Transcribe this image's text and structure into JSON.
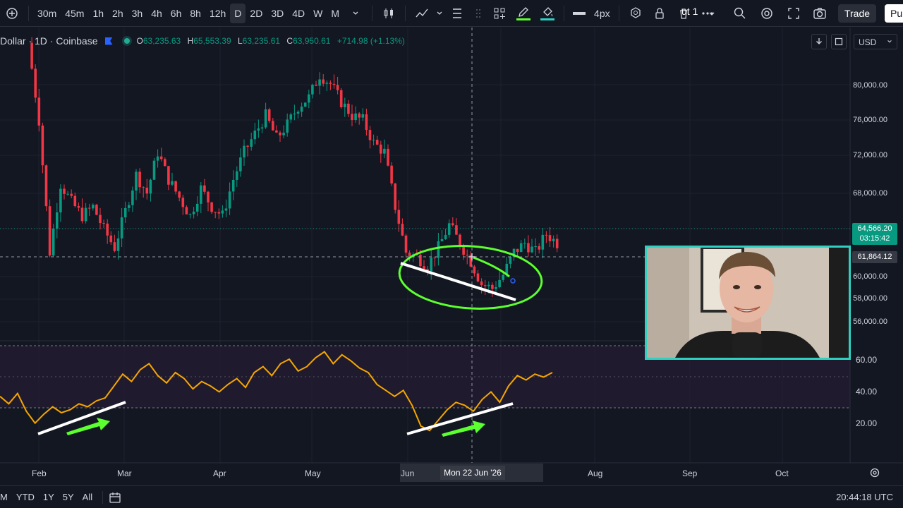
{
  "toolbar": {
    "intervals": [
      "30m",
      "45m",
      "1h",
      "2h",
      "3h",
      "4h",
      "6h",
      "8h",
      "12h",
      "D",
      "2D",
      "3D",
      "4D",
      "W",
      "M"
    ],
    "active_interval": "D",
    "stroke_width": "4px",
    "layout_name": "ut 1",
    "trade_label": "Trade",
    "publish_label": "Pu"
  },
  "legend": {
    "symbol": "Dollar · 1D · Coinbase",
    "open_label": "O",
    "open": "63,235.63",
    "high_label": "H",
    "high": "65,553.39",
    "low_label": "L",
    "low": "63,235.61",
    "close_label": "C",
    "close": "63,950.61",
    "change": "+714.98 (+1.13%)"
  },
  "currency": "USD",
  "price_axis": [
    "80,000.00",
    "76,000.00",
    "72,000.00",
    "68,000.00",
    "60,000.00",
    "58,000.00",
    "56,000.00"
  ],
  "price_tags": {
    "last_price": "64,566.20",
    "countdown": "03:15:42",
    "crosshair_price": "61,864.12"
  },
  "osc_axis": [
    "60.00",
    "40.00",
    "20.00"
  ],
  "time_axis": [
    "Feb",
    "Mar",
    "Apr",
    "May",
    "Jun",
    "Aug",
    "Sep",
    "Oct"
  ],
  "crosshair_date": "Mon 22 Jun '26",
  "bottom": {
    "ranges": [
      "YTD",
      "1Y",
      "5Y",
      "All"
    ],
    "utc_time": "20:44:18 UTC"
  },
  "colors": {
    "up": "#089981",
    "down": "#f23645",
    "oscillator": "#f7a600",
    "annotation": "#5cff2f",
    "webcam_border": "#2fd0c0"
  },
  "chart_data": [
    {
      "type": "candlestick",
      "title": "",
      "ylabel": "",
      "ylim": [
        53000,
        84000
      ],
      "closing_path": [
        [
          0,
          85500
        ],
        [
          3,
          77000
        ],
        [
          6,
          62500
        ],
        [
          9,
          70000
        ],
        [
          12,
          68000
        ],
        [
          15,
          66500
        ],
        [
          18,
          67500
        ],
        [
          21,
          65000
        ],
        [
          24,
          63000
        ],
        [
          27,
          67000
        ],
        [
          30,
          71000
        ],
        [
          33,
          69000
        ],
        [
          36,
          73500
        ],
        [
          39,
          70500
        ],
        [
          42,
          68500
        ],
        [
          45,
          66500
        ],
        [
          48,
          69500
        ],
        [
          51,
          67500
        ],
        [
          54,
          66500
        ],
        [
          57,
          70500
        ],
        [
          60,
          73500
        ],
        [
          63,
          75500
        ],
        [
          66,
          77500
        ],
        [
          69,
          75000
        ],
        [
          72,
          76500
        ],
        [
          75,
          78500
        ],
        [
          78,
          79500
        ],
        [
          81,
          82000
        ],
        [
          84,
          81000
        ],
        [
          87,
          79000
        ],
        [
          90,
          77500
        ],
        [
          93,
          77000
        ],
        [
          96,
          74500
        ],
        [
          99,
          73500
        ],
        [
          102,
          67500
        ],
        [
          105,
          62500
        ],
        [
          108,
          62000
        ],
        [
          111,
          61000
        ],
        [
          114,
          63000
        ],
        [
          117,
          65500
        ],
        [
          120,
          63500
        ],
        [
          123,
          61500
        ],
        [
          126,
          59000
        ],
        [
          129,
          58500
        ],
        [
          132,
          60000
        ],
        [
          135,
          62500
        ],
        [
          138,
          63500
        ],
        [
          141,
          62500
        ],
        [
          144,
          64500
        ],
        [
          147,
          63500
        ]
      ]
    },
    {
      "type": "line",
      "title": "",
      "ylim": [
        10,
        75
      ],
      "values": [
        40,
        35,
        42,
        30,
        22,
        28,
        33,
        29,
        31,
        35,
        33,
        37,
        39,
        47,
        55,
        50,
        58,
        62,
        54,
        49,
        56,
        52,
        45,
        50,
        47,
        43,
        48,
        52,
        46,
        56,
        60,
        54,
        62,
        65,
        57,
        60,
        66,
        70,
        62,
        68,
        64,
        59,
        56,
        48,
        44,
        40,
        44,
        34,
        20,
        17,
        24,
        31,
        36,
        34,
        30,
        38,
        43,
        36,
        47,
        54,
        51,
        55,
        53,
        56
      ]
    }
  ]
}
